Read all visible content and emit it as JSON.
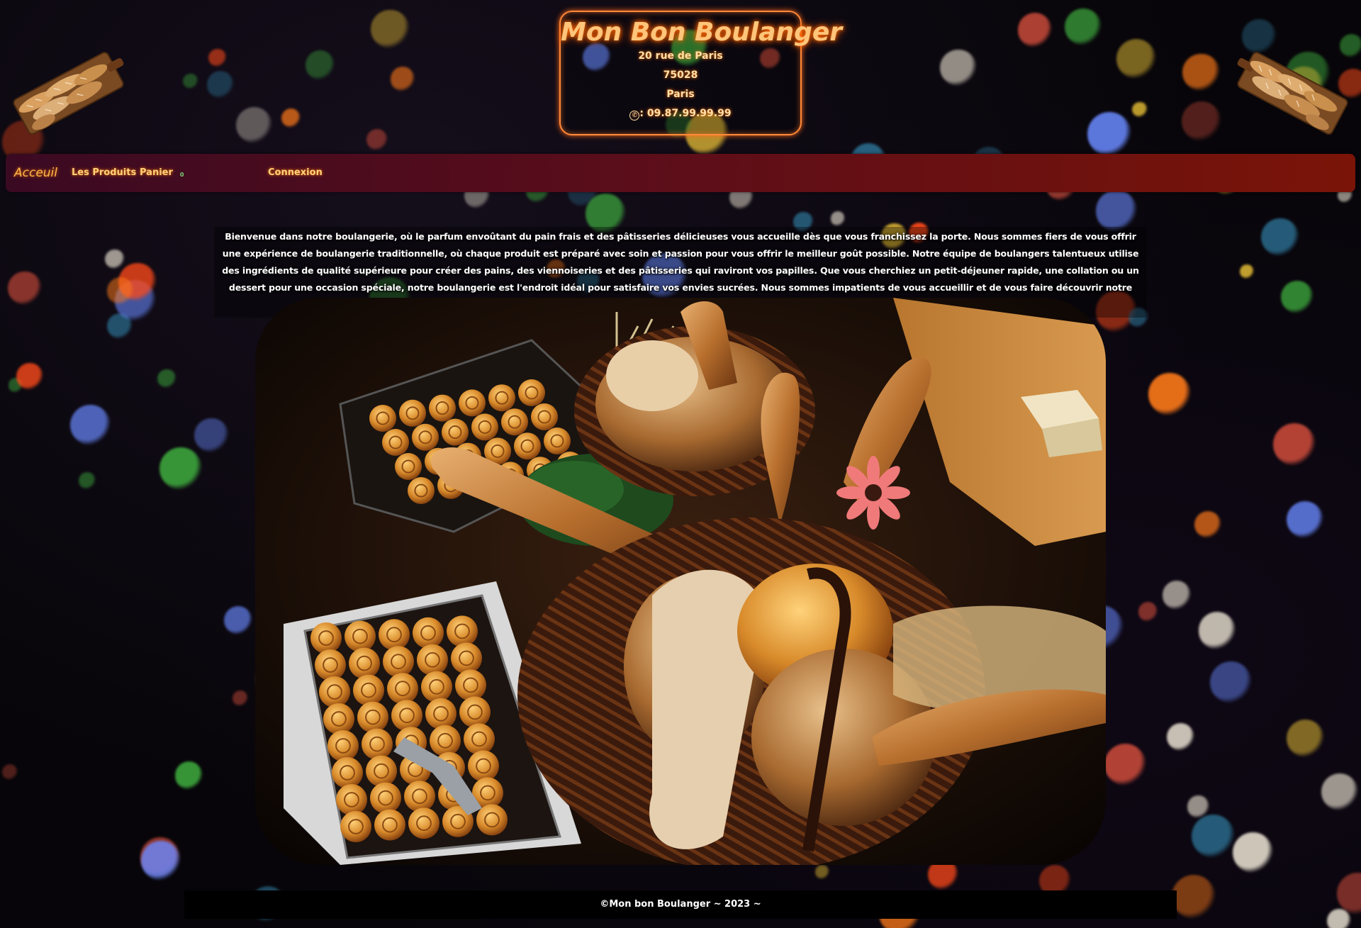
{
  "header": {
    "title": "Mon Bon Boulanger",
    "address_line1": "20 rue de Paris",
    "postal_code": "75028",
    "city": "Paris",
    "phone_icon": "phone-icon",
    "phone": ": 09.87.99.99.99",
    "decoration_image": "bread-cutting-board"
  },
  "nav": {
    "home": "Acceuil",
    "products": "Les Produits",
    "cart": "Panier",
    "cart_count": "0",
    "login": "Connexion"
  },
  "intro": {
    "text": "Bienvenue dans notre boulangerie, où le parfum envoûtant du pain frais et des pâtisseries délicieuses vous accueille dès que vous franchissez la porte. Nous sommes fiers de vous offrir une expérience de boulangerie traditionnelle, où chaque produit est préparé avec soin et passion pour vous offrir le meilleur goût possible. Notre équipe de boulangers talentueux utilise des ingrédients de qualité supérieure pour créer des pains, des viennoiseries et des pâtisseries qui raviront vos papilles. Que vous cherchiez un petit-déjeuner rapide, une collation ou un dessert pour une occasion spéciale, notre boulangerie est l'endroit idéal pour satisfaire vos envies sucrées. Nous sommes impatients de vous accueillir et de vous faire découvrir notre sélection de produits artisanaux et délicieux."
  },
  "hero": {
    "image": "bakery-bread-display"
  },
  "footer": {
    "text": "©Mon bon Boulanger ~ 2023 ~"
  },
  "colors": {
    "accent": "#ff8a3a",
    "title": "#ffc57a",
    "nav_start": "#3a0a22",
    "nav_end": "#7a1408"
  }
}
